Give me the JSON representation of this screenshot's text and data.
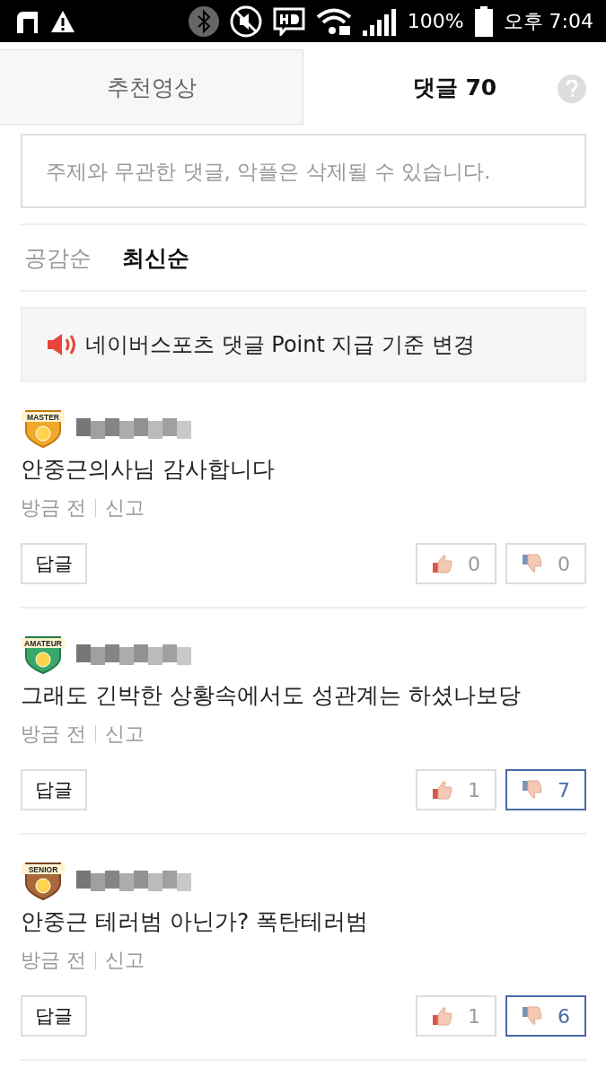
{
  "status_bar": {
    "battery": "100%",
    "time": "오후 7:04"
  },
  "tabs": [
    {
      "label": "추천영상",
      "selected": false
    },
    {
      "label": "댓글 70",
      "selected": true
    }
  ],
  "comment_input": {
    "placeholder": "주제와 무관한 댓글, 악플은 삭제될 수 있습니다."
  },
  "sort_options": [
    {
      "label": "공감순",
      "selected": false
    },
    {
      "label": "최신순",
      "selected": true
    }
  ],
  "notice": {
    "text": "네이버스포츠 댓글 Point 지급 기준 변경"
  },
  "comments": [
    {
      "grade": "MASTER",
      "kind": "master",
      "text": "안중근의사님 감사합니다",
      "time": "방금 전",
      "report": "신고",
      "reply": "답글",
      "likes": "0",
      "dislikes": "0",
      "liked": false,
      "disliked": false
    },
    {
      "grade": "AMATEUR",
      "kind": "amateur",
      "text": "그래도 긴박한 상황속에서도 성관계는 하셨나보당",
      "time": "방금 전",
      "report": "신고",
      "reply": "답글",
      "likes": "1",
      "dislikes": "7",
      "liked": false,
      "disliked": true
    },
    {
      "grade": "SENIOR",
      "kind": "senior",
      "text": "안중근 테러범 아닌가? 폭탄테러범",
      "time": "방금 전",
      "report": "신고",
      "reply": "답글",
      "likes": "1",
      "dislikes": "6",
      "liked": false,
      "disliked": true
    }
  ]
}
